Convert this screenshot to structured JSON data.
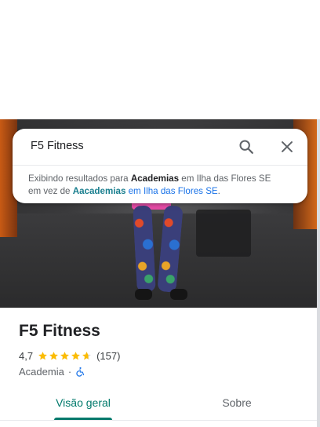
{
  "search": {
    "query": "F5 Fitness",
    "suggestion": {
      "prefix": "Exibindo resultados para ",
      "corrected_term": "Academias",
      "corrected_location": " em Ilha das Flores SE",
      "middle": "em vez de ",
      "original_term": "Aacademias",
      "original_location": " em Ilha das Flores SE",
      "suffix": "."
    }
  },
  "place": {
    "name": "F5 Fitness",
    "rating": "4,7",
    "rating_value": 4.7,
    "reviews": "(157)",
    "category": "Academia",
    "separator": "·"
  },
  "tabs": [
    {
      "label": "Visão geral",
      "selected": true
    },
    {
      "label": "Sobre",
      "selected": false
    }
  ],
  "colors": {
    "accent": "#00796b",
    "star": "#fbbc04",
    "link": "#1a73e8",
    "accessibility": "#1a73e8"
  },
  "icons": [
    "search-icon",
    "close-icon",
    "star-icon",
    "wheelchair-icon"
  ]
}
